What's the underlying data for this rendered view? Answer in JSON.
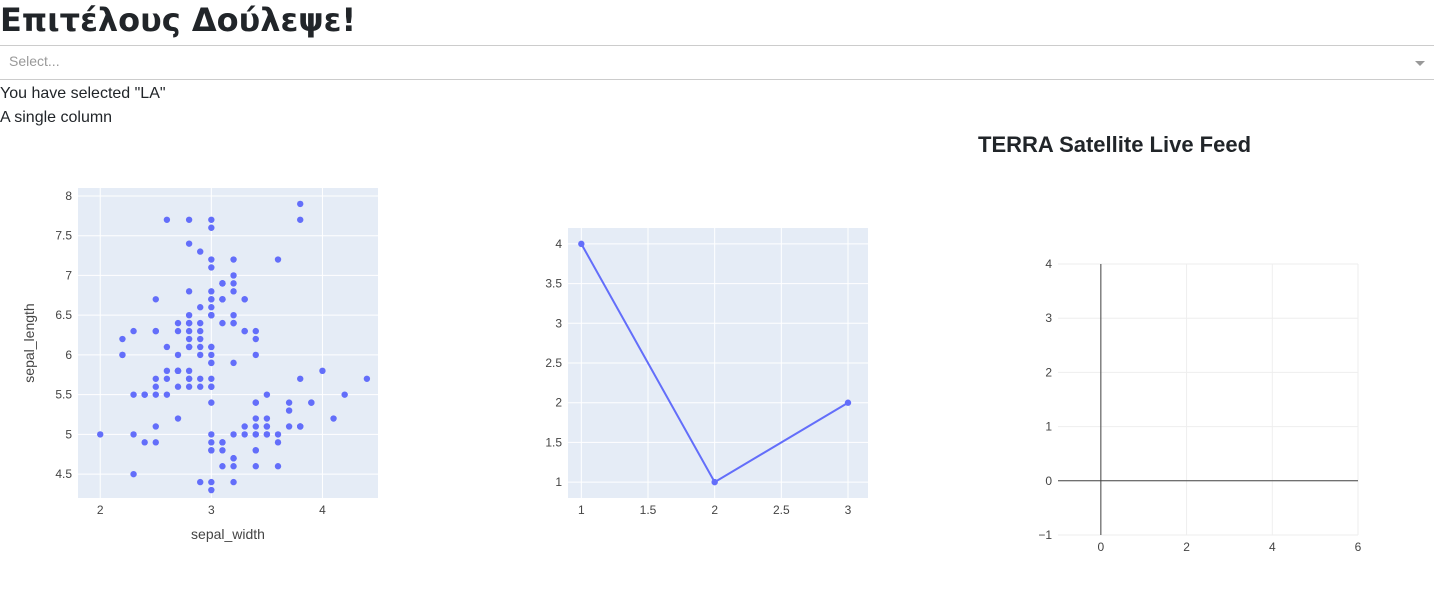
{
  "page_title": "Επιτέλους Δούλεψε!",
  "dropdown": {
    "placeholder": "Select...",
    "arrow_icon": "chevron-down-icon"
  },
  "selection_text": "You have selected \"LA\"",
  "single_column_text": "A single column",
  "satellite_title": "TERRA Satellite Live Feed",
  "colors": {
    "marker": "#636efa",
    "plot_bg": "#e5ecf6",
    "axis_text": "#444444"
  },
  "chart_data": [
    {
      "type": "scatter",
      "xlabel": "sepal_width",
      "ylabel": "sepal_length",
      "xlim": [
        1.8,
        4.5
      ],
      "ylim": [
        4.2,
        8.1
      ],
      "x_ticks": [
        "2",
        "3",
        "4"
      ],
      "x_tick_values": [
        2,
        3,
        4
      ],
      "y_ticks": [
        "4.5",
        "5",
        "5.5",
        "6",
        "6.5",
        "7",
        "7.5",
        "8"
      ],
      "y_tick_values": [
        4.5,
        5,
        5.5,
        6,
        6.5,
        7,
        7.5,
        8
      ],
      "x": [
        3.5,
        3.0,
        3.2,
        3.1,
        3.6,
        3.9,
        3.4,
        3.4,
        2.9,
        3.1,
        3.7,
        3.4,
        3.0,
        3.0,
        4.0,
        4.4,
        3.9,
        3.5,
        3.8,
        3.8,
        3.4,
        3.7,
        3.6,
        3.3,
        3.4,
        3.0,
        3.4,
        3.5,
        3.4,
        3.2,
        3.1,
        3.4,
        4.1,
        4.2,
        3.1,
        3.2,
        3.5,
        3.6,
        3.0,
        3.4,
        3.5,
        2.3,
        3.2,
        3.5,
        3.8,
        3.0,
        3.8,
        3.2,
        3.7,
        3.3,
        3.2,
        3.2,
        3.1,
        2.3,
        2.8,
        2.8,
        3.3,
        2.4,
        2.9,
        2.7,
        2.0,
        3.0,
        2.2,
        2.9,
        2.9,
        3.1,
        3.0,
        2.7,
        2.2,
        2.5,
        3.2,
        2.8,
        2.5,
        2.8,
        2.9,
        3.0,
        2.8,
        3.0,
        2.9,
        2.6,
        2.4,
        2.4,
        2.7,
        2.7,
        3.0,
        3.4,
        3.1,
        2.3,
        3.0,
        2.5,
        2.6,
        3.0,
        2.6,
        2.3,
        2.7,
        3.0,
        2.9,
        2.9,
        2.5,
        2.8,
        3.3,
        2.7,
        3.0,
        2.9,
        3.0,
        3.0,
        2.5,
        2.9,
        2.5,
        3.6,
        3.2,
        2.7,
        3.0,
        2.5,
        2.8,
        3.2,
        3.0,
        3.8,
        2.6,
        2.2,
        3.2,
        2.8,
        2.8,
        2.7,
        3.3,
        3.2,
        2.8,
        3.0,
        2.8,
        3.0,
        2.8,
        3.8,
        2.8,
        2.8,
        2.6,
        3.0,
        3.4,
        3.1,
        3.0,
        3.1,
        3.1,
        3.1,
        2.7,
        3.2,
        3.3,
        3.0,
        2.5,
        3.0,
        3.4,
        3.0
      ],
      "y": [
        5.1,
        4.9,
        4.7,
        4.6,
        5.0,
        5.4,
        4.6,
        5.0,
        4.4,
        4.9,
        5.4,
        4.8,
        4.8,
        4.3,
        5.8,
        5.7,
        5.4,
        5.1,
        5.7,
        5.1,
        5.4,
        5.1,
        4.6,
        5.1,
        4.8,
        5.0,
        5.0,
        5.2,
        5.2,
        4.7,
        4.8,
        5.4,
        5.2,
        5.5,
        4.9,
        5.0,
        5.5,
        4.9,
        4.4,
        5.1,
        5.0,
        4.5,
        4.4,
        5.0,
        5.1,
        4.8,
        5.1,
        4.6,
        5.3,
        5.0,
        7.0,
        6.4,
        6.9,
        5.5,
        6.5,
        5.7,
        6.3,
        4.9,
        6.6,
        5.2,
        5.0,
        5.9,
        6.0,
        6.1,
        5.6,
        6.7,
        5.6,
        5.8,
        6.2,
        5.6,
        5.9,
        6.1,
        6.3,
        6.1,
        6.4,
        6.6,
        6.8,
        6.7,
        6.0,
        5.7,
        5.5,
        5.5,
        5.8,
        6.0,
        5.4,
        6.0,
        6.7,
        6.3,
        5.6,
        5.5,
        5.5,
        6.1,
        5.8,
        5.0,
        5.6,
        5.7,
        5.7,
        6.2,
        5.1,
        5.7,
        6.3,
        5.8,
        7.1,
        6.3,
        6.5,
        7.6,
        4.9,
        7.3,
        6.7,
        7.2,
        6.5,
        6.4,
        6.8,
        5.7,
        5.8,
        6.4,
        6.5,
        7.7,
        7.7,
        6.0,
        6.9,
        5.6,
        7.7,
        6.3,
        6.7,
        7.2,
        6.2,
        6.1,
        6.4,
        7.2,
        7.4,
        7.9,
        6.4,
        6.3,
        6.1,
        7.7,
        6.3,
        6.4,
        6.0,
        6.9,
        6.7,
        6.9,
        5.8,
        6.8,
        6.7,
        6.7,
        6.3,
        6.5,
        6.2,
        5.9
      ]
    },
    {
      "type": "line",
      "xlabel": "",
      "ylabel": "",
      "xlim": [
        0.9,
        3.15
      ],
      "ylim": [
        0.8,
        4.2
      ],
      "x_ticks": [
        "1",
        "1.5",
        "2",
        "2.5",
        "3"
      ],
      "x_tick_values": [
        1,
        1.5,
        2,
        2.5,
        3
      ],
      "y_ticks": [
        "1",
        "1.5",
        "2",
        "2.5",
        "3",
        "3.5",
        "4"
      ],
      "y_tick_values": [
        1,
        1.5,
        2,
        2.5,
        3,
        3.5,
        4
      ],
      "x": [
        1,
        2,
        3
      ],
      "y": [
        4,
        1,
        2
      ]
    },
    {
      "type": "scatter",
      "xlabel": "",
      "ylabel": "",
      "xlim": [
        -1,
        6
      ],
      "ylim": [
        -1,
        4
      ],
      "x_ticks": [
        "0",
        "2",
        "4",
        "6"
      ],
      "x_tick_values": [
        0,
        2,
        4,
        6
      ],
      "y_ticks": [
        "−1",
        "0",
        "1",
        "2",
        "3",
        "4"
      ],
      "y_tick_values": [
        -1,
        0,
        1,
        2,
        3,
        4
      ],
      "x": [],
      "y": []
    }
  ]
}
